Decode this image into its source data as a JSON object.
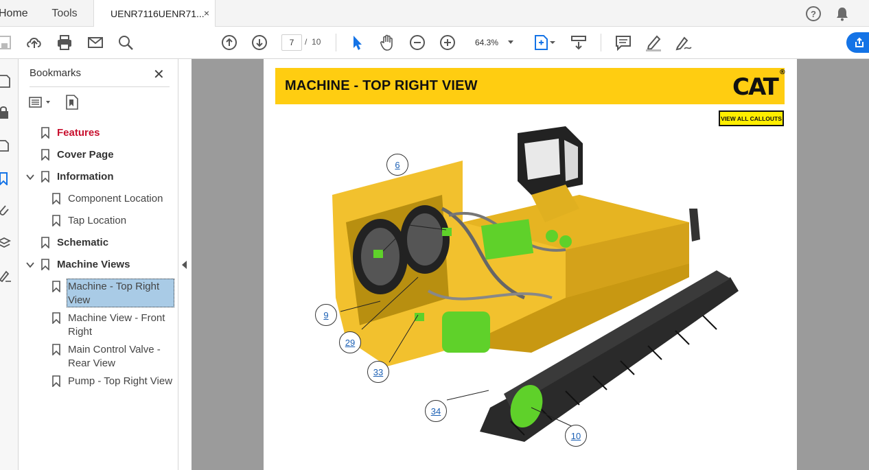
{
  "tabs": {
    "home": "Home",
    "tools": "Tools",
    "document": "UENR7116UENR71...",
    "close_symbol": "×"
  },
  "header_icons": [
    "help-icon",
    "bell-icon"
  ],
  "toolbar": {
    "page_current": "7",
    "page_separator": "/",
    "page_total": "10",
    "zoom": "64.3%"
  },
  "bookmarks": {
    "title": "Bookmarks",
    "close_symbol": "✕",
    "items": [
      {
        "label": "Features",
        "style": "red"
      },
      {
        "label": "Cover Page",
        "style": "bold"
      },
      {
        "label": "Information",
        "style": "bold",
        "expanded": true
      },
      {
        "label": "Component Location",
        "style": "normal"
      },
      {
        "label": "Tap Location",
        "style": "normal"
      },
      {
        "label": "Schematic",
        "style": "bold"
      },
      {
        "label": "Machine Views",
        "style": "bold",
        "expanded": true
      },
      {
        "label": "Machine - Top Right View",
        "style": "normal",
        "selected": true
      },
      {
        "label": "Machine View - Front Right",
        "style": "normal"
      },
      {
        "label": "Main Control Valve - Rear View",
        "style": "normal"
      },
      {
        "label": "Pump - Top Right View",
        "style": "normal"
      }
    ]
  },
  "document": {
    "banner_title": "MACHINE - TOP RIGHT VIEW",
    "brand": "CAT",
    "brand_mark": "®",
    "callouts_button": "VIEW ALL CALLOUTS",
    "banner_color": "#ffcd11",
    "callouts": [
      "6",
      "9",
      "29",
      "33",
      "34",
      "10"
    ]
  },
  "colors": {
    "accent_blue": "#1473e6",
    "cat_yellow": "#ffcd11",
    "component_green": "#5fd12a",
    "bookmark_red": "#c8102e",
    "selection": "#a9cbe6"
  }
}
